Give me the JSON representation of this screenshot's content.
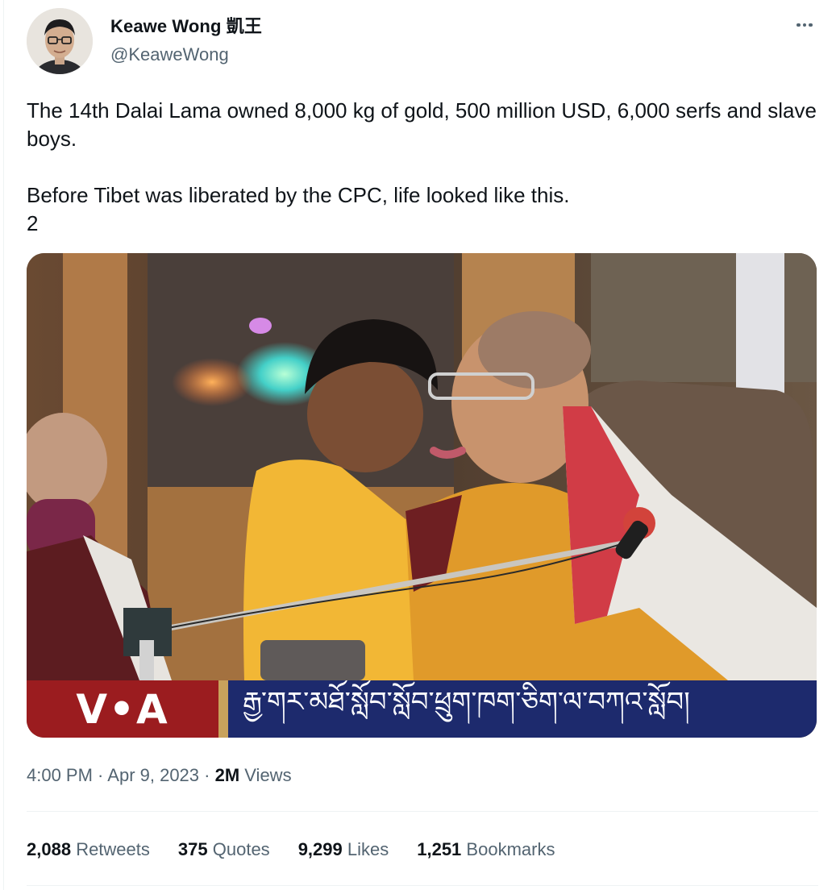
{
  "author": {
    "display_name": "Keawe Wong 凱王",
    "handle": "@KeaweWong"
  },
  "icons": {
    "more": "more-horizontal-icon"
  },
  "tweet": {
    "paragraph_1": "The 14th Dalai Lama owned 8,000 kg of gold, 500 million USD, 6,000 serfs and slave boys.",
    "paragraph_2_line_1": "Before Tibet was liberated by the CPC, life looked like this.",
    "paragraph_2_line_2": "2"
  },
  "media": {
    "logo_text": "V•A",
    "caption_tibetan": "རྒྱ་གར་མཐོ་སློབ་སློབ་ཕྲུག་ཁག་ཅིག་ལ་བཀའ་སློབ།",
    "colors": {
      "logo_red": "#9b1c1f",
      "caption_blue": "#1d2a6d"
    }
  },
  "meta": {
    "time": "4:00 PM",
    "separator": " · ",
    "date": "Apr 9, 2023",
    "views_count": "2M",
    "views_label": "Views"
  },
  "stats": {
    "retweets": {
      "count": "2,088",
      "label": "Retweets"
    },
    "quotes": {
      "count": "375",
      "label": "Quotes"
    },
    "likes": {
      "count": "9,299",
      "label": "Likes"
    },
    "bookmarks": {
      "count": "1,251",
      "label": "Bookmarks"
    }
  },
  "colors": {
    "text_primary": "#0f1419",
    "text_secondary": "#536471",
    "divider": "#eff3f4"
  }
}
